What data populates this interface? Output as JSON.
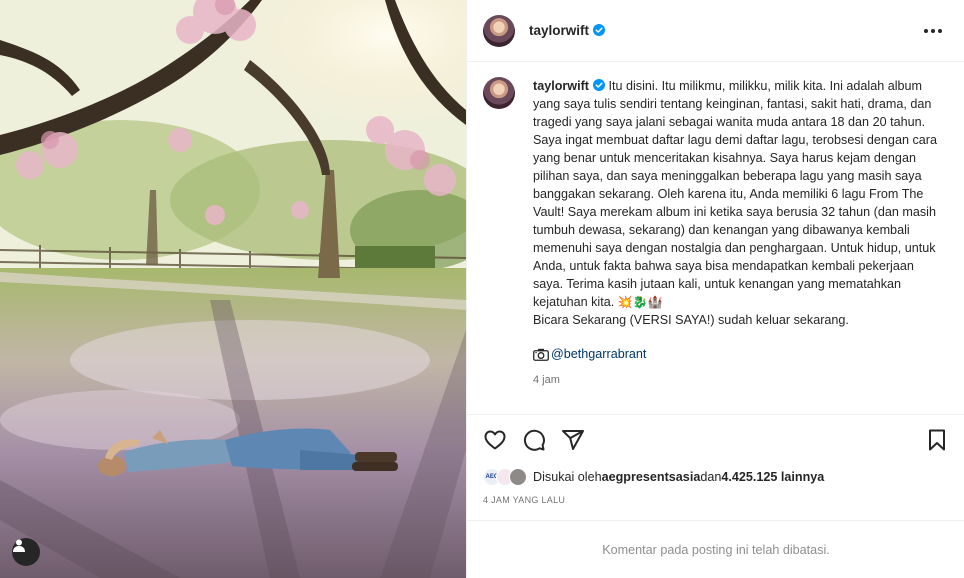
{
  "post": {
    "username": "taylorwift",
    "caption_user": "taylorwift",
    "caption": "Itu disini. Itu milikmu, milikku, milik kita. Ini adalah album yang saya tulis sendiri tentang keinginan, fantasi, sakit hati, drama, dan tragedi yang saya jalani sebagai wanita muda antara 18 dan 20 tahun. Saya ingat membuat daftar lagu demi daftar lagu, terobsesi dengan cara yang benar untuk menceritakan kisahnya. Saya harus kejam dengan pilihan saya, dan saya meninggalkan beberapa lagu yang masih saya banggakan sekarang. Oleh karena itu, Anda memiliki 6 lagu From The Vault! Saya merekam album ini ketika saya berusia 32 tahun (dan masih tumbuh dewasa, sekarang) dan kenangan yang dibawanya kembali memenuhi saya dengan nostalgia dan penghargaan. Untuk hidup, untuk Anda, untuk fakta bahwa saya bisa mendapatkan kembali pekerjaan saya. Terima kasih jutaan kali, untuk kenangan yang mematahkan kejatuhan kita.",
    "caption_emojis": "💥🐉🏰",
    "caption_tail": "Bicara Sekarang (VERSI SAYA!) sudah keluar sekarang.",
    "photo_credit": "@bethgarrabrant",
    "time_short": "4 jam",
    "likes_prefix": "Disukai oleh ",
    "likes_user": "aegpresentsasia",
    "likes_mid": " dan ",
    "likes_count": "4.425.125 lainnya",
    "time_ago": "4 JAM YANG LALU",
    "comments_restricted": "Komentar pada posting ini telah dibatasi.",
    "mini_avatar_labels": [
      "AEG",
      "",
      ""
    ]
  },
  "icons": {
    "header_more": "more-horizontal-icon",
    "verified": "verified-badge-icon",
    "like": "heart-icon",
    "comment": "comment-bubble-icon",
    "share": "paper-plane-icon",
    "save": "bookmark-icon",
    "tag": "person-tag-icon",
    "camera": "camera-icon"
  },
  "colors": {
    "verified_blue": "#0095f6",
    "link": "#00376b",
    "muted": "#737373"
  }
}
